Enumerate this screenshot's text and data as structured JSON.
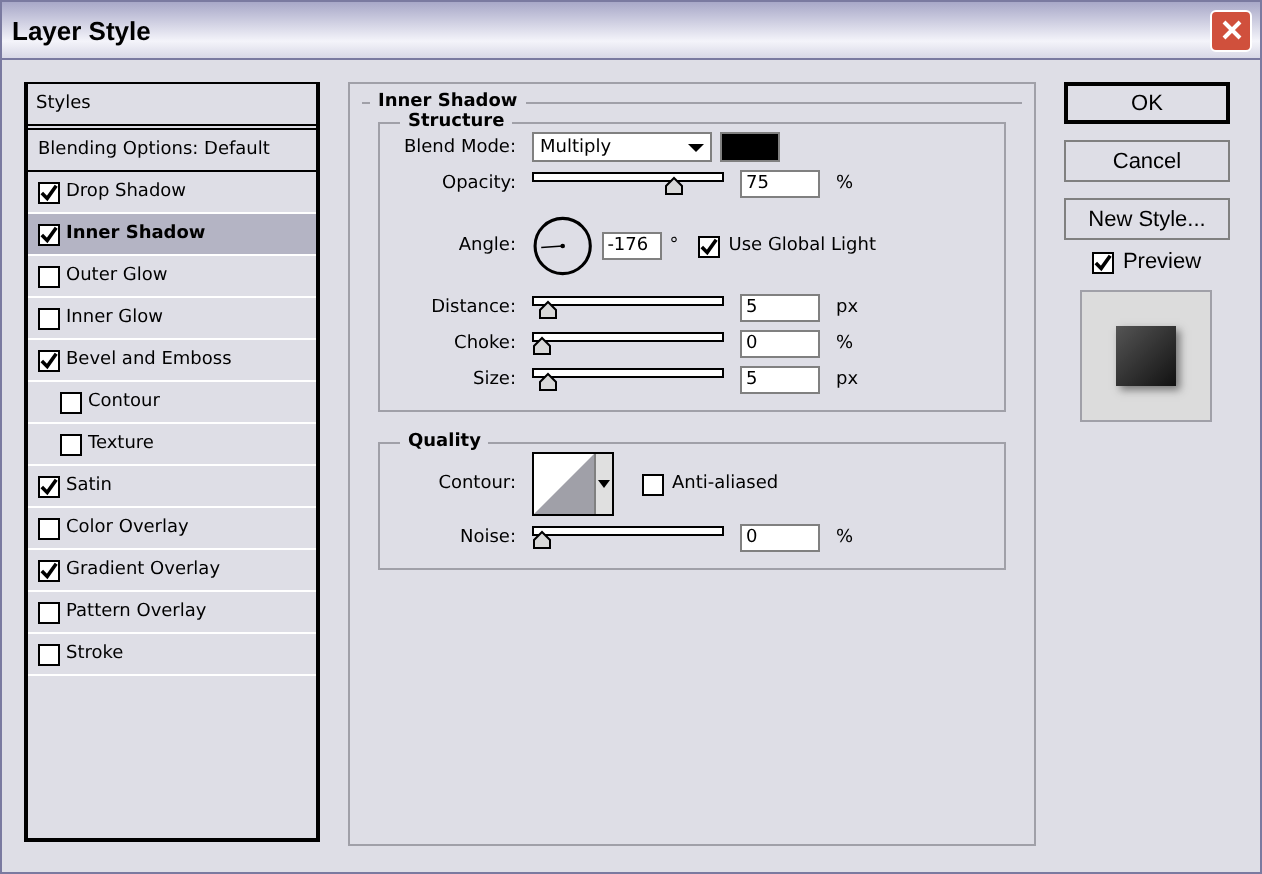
{
  "window": {
    "title": "Layer Style"
  },
  "sidebar": {
    "header": "Styles",
    "blending": "Blending Options: Default",
    "items": [
      {
        "label": "Drop Shadow",
        "checked": true,
        "selected": false
      },
      {
        "label": "Inner Shadow",
        "checked": true,
        "selected": true
      },
      {
        "label": "Outer Glow",
        "checked": false,
        "selected": false
      },
      {
        "label": "Inner Glow",
        "checked": false,
        "selected": false
      },
      {
        "label": "Bevel and Emboss",
        "checked": true,
        "selected": false,
        "children": [
          {
            "label": "Contour",
            "checked": false,
            "selected": false
          },
          {
            "label": "Texture",
            "checked": false,
            "selected": false
          }
        ]
      },
      {
        "label": "Satin",
        "checked": true,
        "selected": false
      },
      {
        "label": "Color Overlay",
        "checked": false,
        "selected": false
      },
      {
        "label": "Gradient Overlay",
        "checked": true,
        "selected": false
      },
      {
        "label": "Pattern Overlay",
        "checked": false,
        "selected": false
      },
      {
        "label": "Stroke",
        "checked": false,
        "selected": false
      }
    ]
  },
  "panel": {
    "title": "Inner Shadow",
    "structure": {
      "title": "Structure",
      "blend_label": "Blend Mode:",
      "blend_value": "Multiply",
      "color": "#000000",
      "opacity": {
        "label": "Opacity:",
        "level": 0.75,
        "value": "75",
        "unit": "%"
      },
      "angle": {
        "label": "Angle:",
        "value": "-176",
        "unit": "°",
        "global_label": "Use Global Light",
        "global_checked": true
      },
      "sliders": [
        {
          "label": "Distance:",
          "level": 0.03,
          "value": "5",
          "unit": "px"
        },
        {
          "label": "Choke:",
          "level": 0,
          "value": "0",
          "unit": "%"
        },
        {
          "label": "Size:",
          "level": 0.03,
          "value": "5",
          "unit": "px"
        }
      ]
    },
    "quality": {
      "title": "Quality",
      "contour_label": "Contour:",
      "antialias_label": "Anti-aliased",
      "antialias_checked": false,
      "noise": {
        "label": "Noise:",
        "level": 0,
        "value": "0",
        "unit": "%"
      }
    }
  },
  "buttons": [
    {
      "label": "OK",
      "default": true
    },
    {
      "label": "Cancel",
      "default": false
    },
    {
      "label": "New Style...",
      "default": false
    }
  ],
  "preview": {
    "label": "Preview",
    "checked": true
  }
}
